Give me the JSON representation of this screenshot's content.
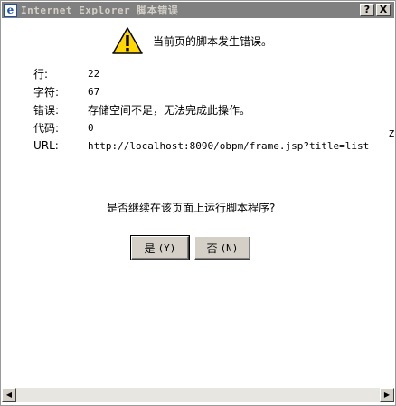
{
  "window": {
    "title": "Internet Explorer 脚本错误",
    "help_label": "?",
    "close_label": "X"
  },
  "header": {
    "message": "当前页的脚本发生错误。"
  },
  "details": [
    {
      "label": "行:",
      "value": "22"
    },
    {
      "label": "字符:",
      "value": "67"
    },
    {
      "label": "错误:",
      "value": "存储空间不足，无法完成此操作。"
    },
    {
      "label": "代码:",
      "value": "0"
    },
    {
      "label": "URL:",
      "value": "http://localhost:8090/obpm/frame.jsp?title=list"
    }
  ],
  "question": "是否继续在该页面上运行脚本程序?",
  "buttons": {
    "yes_label": "是",
    "yes_accel": "(Y)",
    "no_label": "否",
    "no_accel": "(N)"
  },
  "icons": {
    "title": "ie-icon",
    "warning": "warning-icon",
    "scroll_left": "scroll-left-icon",
    "scroll_right": "scroll-right-icon"
  },
  "colors": {
    "titlebar": "#808080",
    "button_face": "#d4d0c8",
    "warning": "#ffd800"
  },
  "stray_text": "z"
}
